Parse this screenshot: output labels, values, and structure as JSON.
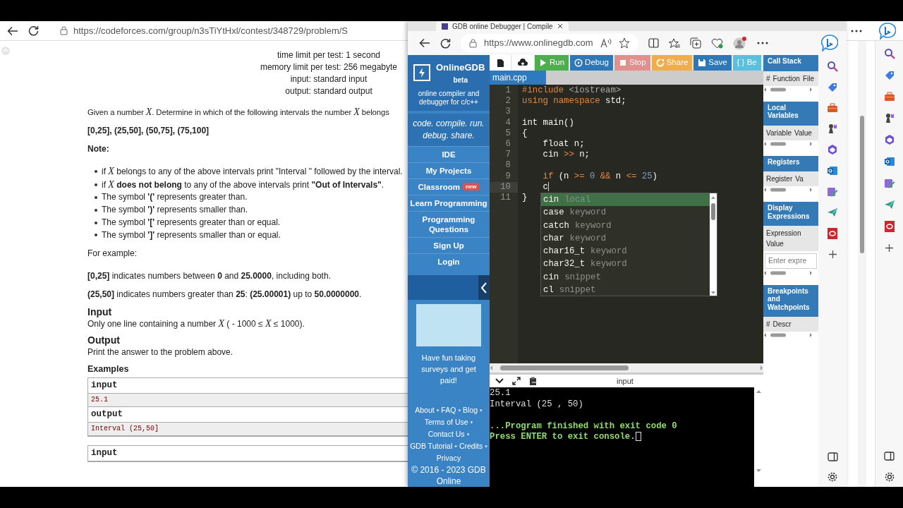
{
  "background_browser": {
    "url": "https://codeforces.com/group/n3sTiYtHxl/contest/348729/problem/S",
    "limits": [
      "time limit per test: 1 second",
      "memory limit per test: 256 megabyte",
      "input: standard input",
      "output: standard output"
    ],
    "statement": "Given a number *X*. Determine in which of the following intervals the number *X* belongs",
    "intervals": "[0,25], (25,50], (50,75], (75,100]",
    "note_title": "Note:",
    "notes": [
      "if *X* belongs to any of the above intervals print \"Interval \" followed by the interval.",
      "if *X* **does not belong** to any of the above intervals print **\"Out of Intervals\"**.",
      "The symbol **'('** represents greater than.",
      "The symbol **')'** represents smaller than.",
      "The symbol **'['** represents greater than or equal.",
      "The symbol **']'** represents smaller than or equal."
    ],
    "example_intro": "For example:",
    "example_lines": [
      "**[0,25]** indicates numbers between **0** and **25.0000**, including both.",
      "**(25,50]** indicates numbers greater than **25**: **(25.00001)** up to **50.0000000**."
    ],
    "input_title": "Input",
    "input_text": "Only one line containing a number *X* ( - 1000 ≤ *X* ≤ 1000).",
    "output_title": "Output",
    "output_text": "Print the answer to the problem above.",
    "examples_title": "Examples",
    "examples": [
      {
        "rows": [
          {
            "label": "input",
            "value": "25.1"
          },
          {
            "label": "output",
            "value": "Interval (25,50]"
          }
        ]
      },
      {
        "rows": [
          {
            "label": "input"
          }
        ]
      }
    ]
  },
  "onlinegdb_browser": {
    "tab_title": "GDB online Debugger | Compile",
    "url": "https://www.onlinegdb.com",
    "sidebar": {
      "brand": "OnlineGDB",
      "beta": "beta",
      "subtitle": "online compiler and debugger for c/c++",
      "slogan": "code. compile. run. debug. share.",
      "menu": [
        {
          "label": "IDE"
        },
        {
          "label": "My Projects"
        },
        {
          "label": "Classroom",
          "badge": "new"
        },
        {
          "label": "Learn Programming"
        },
        {
          "label": "Programming Questions"
        },
        {
          "label": "Sign Up"
        },
        {
          "label": "Login"
        }
      ],
      "ad_caption": "Have fun taking surveys and get paid!",
      "footer": [
        {
          "kind": "link",
          "text": "About"
        },
        {
          "kind": "sep",
          "text": "•"
        },
        {
          "kind": "link",
          "text": "FAQ"
        },
        {
          "kind": "sep",
          "text": "•"
        },
        {
          "kind": "link",
          "text": "Blog"
        },
        {
          "kind": "sep",
          "text": "•"
        },
        {
          "kind": "link",
          "text": "Terms of Use"
        },
        {
          "kind": "sep",
          "text": "•"
        },
        {
          "kind": "link",
          "text": "Contact Us"
        },
        {
          "kind": "sep",
          "text": "•"
        },
        {
          "kind": "link",
          "text": "GDB Tutorial"
        },
        {
          "kind": "sep",
          "text": "•"
        },
        {
          "kind": "link",
          "text": "Credits"
        },
        {
          "kind": "sep",
          "text": "•"
        },
        {
          "kind": "link",
          "text": "Privacy"
        }
      ],
      "copyright": "© 2016 - 2023 GDB Online"
    },
    "toolbar": [
      {
        "kind": "run",
        "label": "Run",
        "disabled": false
      },
      {
        "kind": "debug",
        "label": "Debug",
        "disabled": false
      },
      {
        "kind": "stop",
        "label": "Stop",
        "disabled": true
      },
      {
        "kind": "share",
        "label": "Share",
        "disabled": false
      },
      {
        "kind": "save",
        "label": "Save",
        "disabled": false
      },
      {
        "kind": "beautify",
        "label": "{ } Be",
        "disabled": false
      }
    ],
    "file_tab": "main.cpp",
    "code": [
      {
        "n": "1",
        "active": false,
        "tokens": [
          {
            "kind": "kw",
            "text": "#include "
          },
          {
            "kind": "inc",
            "text": "<iostream>"
          }
        ]
      },
      {
        "n": "2",
        "active": false,
        "tokens": [
          {
            "kind": "kw",
            "text": "using namespace"
          },
          {
            "kind": "plain",
            "text": " std;"
          }
        ]
      },
      {
        "n": "3",
        "active": false
      },
      {
        "n": "4",
        "active": false,
        "tokens": [
          {
            "kind": "plain",
            "text": "int main()"
          }
        ]
      },
      {
        "n": "5",
        "active": false,
        "tokens": [
          {
            "kind": "plain",
            "text": "{"
          }
        ]
      },
      {
        "n": "6",
        "active": false,
        "tokens": [
          {
            "kind": "plain",
            "text": "    float n;"
          }
        ]
      },
      {
        "n": "7",
        "active": false,
        "tokens": [
          {
            "kind": "plain",
            "text": "    cin "
          },
          {
            "kind": "op",
            "text": ">>"
          },
          {
            "kind": "plain",
            "text": " n;"
          }
        ]
      },
      {
        "n": "8",
        "active": false
      },
      {
        "n": "9",
        "active": false,
        "tokens": [
          {
            "kind": "kw",
            "text": "    if"
          },
          {
            "kind": "plain",
            "text": " (n "
          },
          {
            "kind": "op",
            "text": ">="
          },
          {
            "kind": "num",
            "text": " 0"
          },
          {
            "kind": "op",
            "text": " &&"
          },
          {
            "kind": "plain",
            "text": " n "
          },
          {
            "kind": "op",
            "text": "<="
          },
          {
            "kind": "num",
            "text": " 25"
          },
          {
            "kind": "plain",
            "text": ")"
          }
        ]
      },
      {
        "n": "10",
        "active": true,
        "tokens": [
          {
            "kind": "plain",
            "text": "    c"
          }
        ]
      },
      {
        "n": "11",
        "active": false,
        "tokens": [
          {
            "kind": "plain",
            "text": "}"
          }
        ]
      }
    ],
    "autocomplete": [
      {
        "word": "cin",
        "type": "local",
        "selected": true
      },
      {
        "word": "case",
        "type": "keyword",
        "selected": false
      },
      {
        "word": "catch",
        "type": "keyword",
        "selected": false
      },
      {
        "word": "char",
        "type": "keyword",
        "selected": false
      },
      {
        "word": "char16_t",
        "type": "keyword",
        "selected": false
      },
      {
        "word": "char32_t",
        "type": "keyword",
        "selected": false
      },
      {
        "word": "cin",
        "type": "snippet",
        "selected": false
      },
      {
        "word": "cl",
        "type": "snippet",
        "selected": false
      }
    ],
    "console_label": "input",
    "console": [
      {
        "kind": "plain",
        "text": "25.1"
      },
      {
        "kind": "plain",
        "text": "Interval (25 , 50)"
      },
      {
        "kind": "status",
        "text": "...Program finished with exit code 0"
      },
      {
        "kind": "status",
        "text": "Press ENTER to exit console."
      }
    ],
    "debug_panels": [
      {
        "title": "Call Stack",
        "columns": [
          "#",
          "Function",
          "File"
        ]
      },
      {
        "title": "Local Variables",
        "columns": [
          "Variable",
          "Value"
        ]
      },
      {
        "title": "Registers",
        "columns": [
          "Register",
          "Va"
        ]
      },
      {
        "title": "Display Expressions",
        "columns": [
          "Expression",
          "Value"
        ],
        "placeholder": "Enter expre"
      },
      {
        "title": "Breakpoints and Watchpoints",
        "columns": [
          "#",
          "Descr"
        ]
      }
    ]
  }
}
